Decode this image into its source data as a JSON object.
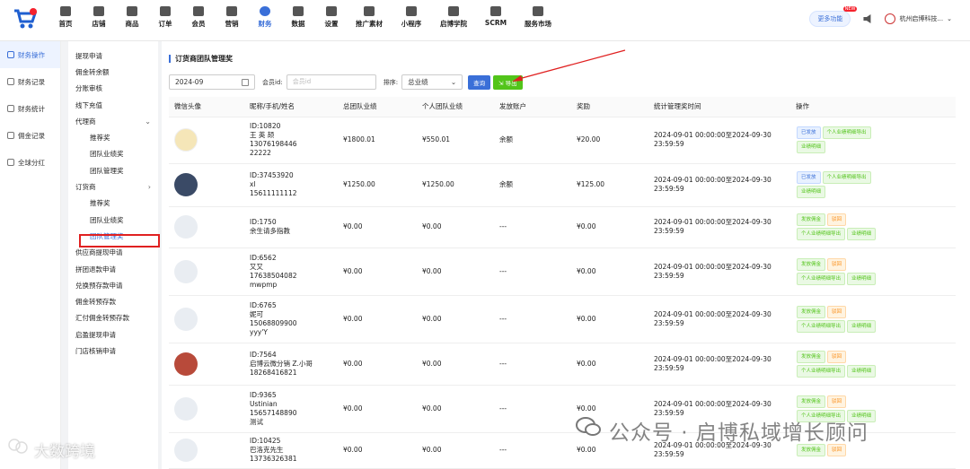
{
  "nav": [
    "首页",
    "店铺",
    "商品",
    "订单",
    "会员",
    "营销",
    "财务",
    "数据",
    "设置",
    "推广素材",
    "小程序",
    "启博学院",
    "SCRM",
    "服务市场"
  ],
  "more": {
    "label": "更多功能",
    "badge": "NEW"
  },
  "company": "杭州启博科技...",
  "side1": [
    "财务操作",
    "财务记录",
    "财务统计",
    "佣金记录",
    "全球分红"
  ],
  "side2": [
    {
      "label": "提现申请",
      "sub": false
    },
    {
      "label": "佣金转余额",
      "sub": false
    },
    {
      "label": "分账审核",
      "sub": false
    },
    {
      "label": "线下充值",
      "sub": false
    },
    {
      "label": "代理商",
      "sub": false,
      "chev": "⌄"
    },
    {
      "label": "推荐奖",
      "sub": true
    },
    {
      "label": "团队业绩奖",
      "sub": true
    },
    {
      "label": "团队管理奖",
      "sub": true
    },
    {
      "label": "订货商",
      "sub": false,
      "chev": "›"
    },
    {
      "label": "推荐奖",
      "sub": true
    },
    {
      "label": "团队业绩奖",
      "sub": true
    },
    {
      "label": "团队管理奖",
      "sub": true,
      "active": true
    },
    {
      "label": "供应商提现申请",
      "sub": false
    },
    {
      "label": "拼团退款申请",
      "sub": false
    },
    {
      "label": "兑换预存款申请",
      "sub": false
    },
    {
      "label": "佣金转预存款",
      "sub": false
    },
    {
      "label": "汇付佣金转预存款",
      "sub": false
    },
    {
      "label": "启盈提现申请",
      "sub": false
    },
    {
      "label": "门店核销申请",
      "sub": false
    }
  ],
  "page": {
    "title": "订货商团队管理奖"
  },
  "filter": {
    "date": "2024-09",
    "member_label": "会员id:",
    "member_placeholder": "会员id",
    "sort_label": "排序:",
    "sort_value": "总业绩",
    "query": "查询",
    "export": "导出"
  },
  "table": {
    "headers": [
      "微信头像",
      "昵称/手机/姓名",
      "总团队业绩",
      "个人团队业绩",
      "发放账户",
      "奖励",
      "统计管理奖时间",
      "操作"
    ],
    "rows": [
      {
        "lines": [
          "ID:10820",
          "王 英 颉",
          "13076198446",
          "22222"
        ],
        "total": "¥1800.01",
        "personal": "¥550.01",
        "account": "余额",
        "reward": "¥20.00",
        "period": [
          "2024-09-01 00:00:00至2024-09-30",
          "23:59:59"
        ],
        "ops": [
          [
            "已发放",
            "blue"
          ],
          [
            "个人业绩明细导出",
            "green"
          ],
          [
            "业绩明细",
            "green"
          ]
        ]
      },
      {
        "lines": [
          "ID:37453920",
          "xl",
          "15611111112"
        ],
        "total": "¥1250.00",
        "personal": "¥1250.00",
        "account": "余额",
        "reward": "¥125.00",
        "period": [
          "2024-09-01 00:00:00至2024-09-30",
          "23:59:59"
        ],
        "ops": [
          [
            "已发放",
            "blue"
          ],
          [
            "个人业绩明细导出",
            "green"
          ],
          [
            "业绩明细",
            "green"
          ]
        ]
      },
      {
        "lines": [
          "ID:1750",
          "余生请多指教"
        ],
        "total": "¥0.00",
        "personal": "¥0.00",
        "account": "---",
        "reward": "¥0.00",
        "period": [
          "2024-09-01 00:00:00至2024-09-30",
          "23:59:59"
        ],
        "ops": [
          [
            "发放佣金",
            "green"
          ],
          [
            "驳回",
            "orange"
          ],
          [
            "个人业绩明细导出",
            "green"
          ],
          [
            "业绩明细",
            "green"
          ]
        ]
      },
      {
        "lines": [
          "ID:6562",
          "又又",
          "17638504082",
          "mwpmp"
        ],
        "total": "¥0.00",
        "personal": "¥0.00",
        "account": "---",
        "reward": "¥0.00",
        "period": [
          "2024-09-01 00:00:00至2024-09-30",
          "23:59:59"
        ],
        "ops": [
          [
            "发放佣金",
            "green"
          ],
          [
            "驳回",
            "orange"
          ],
          [
            "个人业绩明细导出",
            "green"
          ],
          [
            "业绩明细",
            "green"
          ]
        ]
      },
      {
        "lines": [
          "ID:6765",
          "妮可",
          "15068809900",
          "yyy'Y"
        ],
        "total": "¥0.00",
        "personal": "¥0.00",
        "account": "---",
        "reward": "¥0.00",
        "period": [
          "2024-09-01 00:00:00至2024-09-30",
          "23:59:59"
        ],
        "ops": [
          [
            "发放佣金",
            "green"
          ],
          [
            "驳回",
            "orange"
          ],
          [
            "个人业绩明细导出",
            "green"
          ],
          [
            "业绩明细",
            "green"
          ]
        ]
      },
      {
        "lines": [
          "ID:7564",
          "启博云微分销 Z.小哥",
          "18268416821"
        ],
        "total": "¥0.00",
        "personal": "¥0.00",
        "account": "---",
        "reward": "¥0.00",
        "period": [
          "2024-09-01 00:00:00至2024-09-30",
          "23:59:59"
        ],
        "ops": [
          [
            "发放佣金",
            "green"
          ],
          [
            "驳回",
            "orange"
          ],
          [
            "个人业绩明细导出",
            "green"
          ],
          [
            "业绩明细",
            "green"
          ]
        ]
      },
      {
        "lines": [
          "ID:9365",
          "Ustinian",
          "15657148890",
          "测试"
        ],
        "total": "¥0.00",
        "personal": "¥0.00",
        "account": "---",
        "reward": "¥0.00",
        "period": [
          "2024-09-01 00:00:00至2024-09-30",
          "23:59:59"
        ],
        "ops": [
          [
            "发放佣金",
            "green"
          ],
          [
            "驳回",
            "orange"
          ],
          [
            "个人业绩明细导出",
            "green"
          ],
          [
            "业绩明细",
            "green"
          ]
        ]
      },
      {
        "lines": [
          "ID:10425",
          "巴洛克先生",
          "13736326381"
        ],
        "total": "¥0.00",
        "personal": "¥0.00",
        "account": "---",
        "reward": "¥0.00",
        "period": [
          "2024-09-01 00:00:00至2024-09-30",
          "23:59:59"
        ],
        "ops": [
          [
            "发放佣金",
            "green"
          ],
          [
            "驳回",
            "orange"
          ]
        ]
      }
    ]
  },
  "watermark": {
    "left": "大数跨境",
    "right": "公众号 · 启博私域增长顾问"
  },
  "colors": {
    "accent": "#3a6fd8",
    "export": "#52c41a",
    "highlight": "#e02020"
  }
}
